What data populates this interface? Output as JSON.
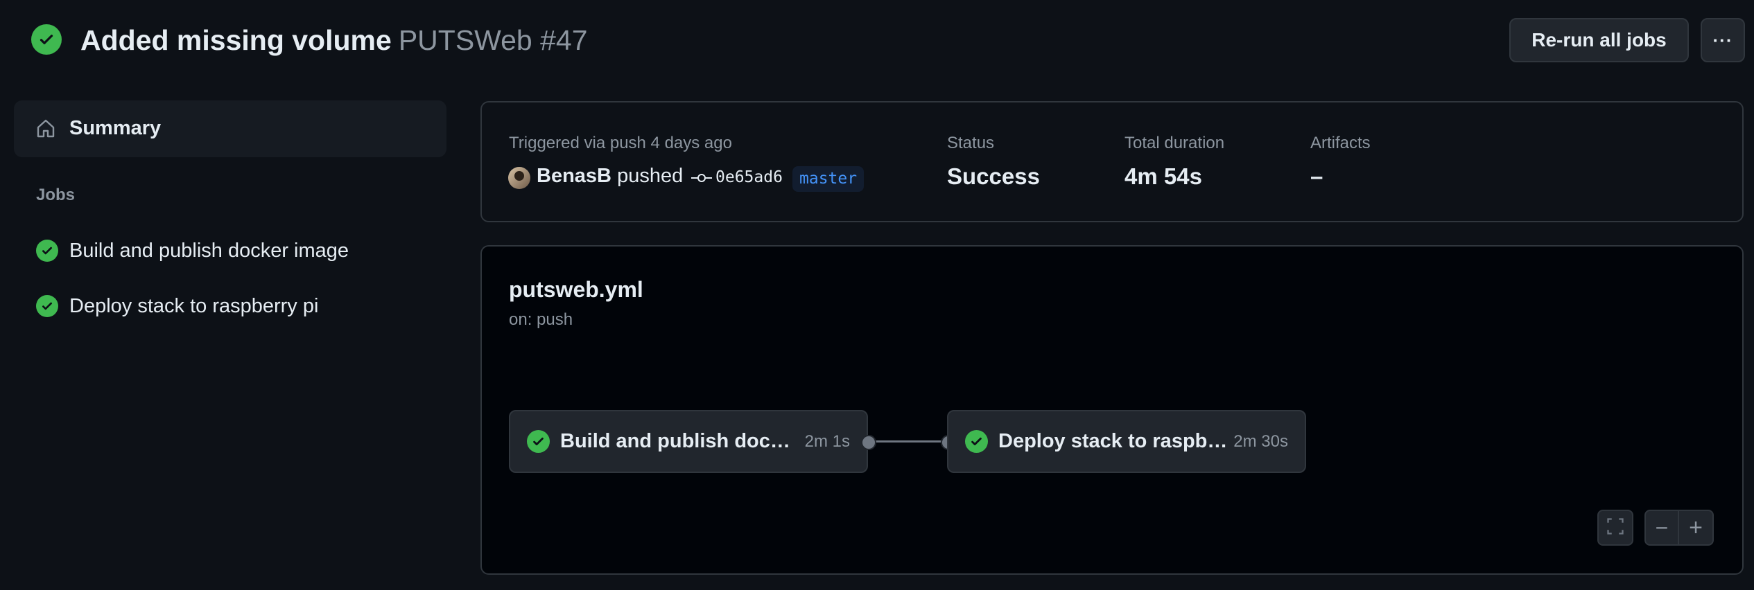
{
  "header": {
    "title": "Added missing volume",
    "workflow_ref": "PUTSWeb #47",
    "rerun_label": "Re-run all jobs",
    "more_label": "···"
  },
  "sidebar": {
    "summary_label": "Summary",
    "jobs_heading": "Jobs",
    "jobs": [
      {
        "label": "Build and publish docker image",
        "status": "success"
      },
      {
        "label": "Deploy stack to raspberry pi",
        "status": "success"
      }
    ]
  },
  "summary": {
    "triggered_text": "Triggered via push 4 days ago",
    "user": "BenasB",
    "action": "pushed",
    "commit_sha": "0e65ad6",
    "branch": "master",
    "status_label": "Status",
    "status_value": "Success",
    "duration_label": "Total duration",
    "duration_value": "4m 54s",
    "artifacts_label": "Artifacts",
    "artifacts_value": "–"
  },
  "graph": {
    "workflow_file": "putsweb.yml",
    "trigger": "on: push",
    "nodes": [
      {
        "name": "Build and publish docker image",
        "duration": "2m 1s"
      },
      {
        "name": "Deploy stack to raspberry pi",
        "duration": "2m 30s"
      }
    ],
    "zoom_out_label": "−",
    "zoom_in_label": "+"
  },
  "colors": {
    "background": "#0d1117",
    "success": "#3fb950",
    "branch_text": "#4493f8",
    "muted_text": "#8d96a0"
  }
}
